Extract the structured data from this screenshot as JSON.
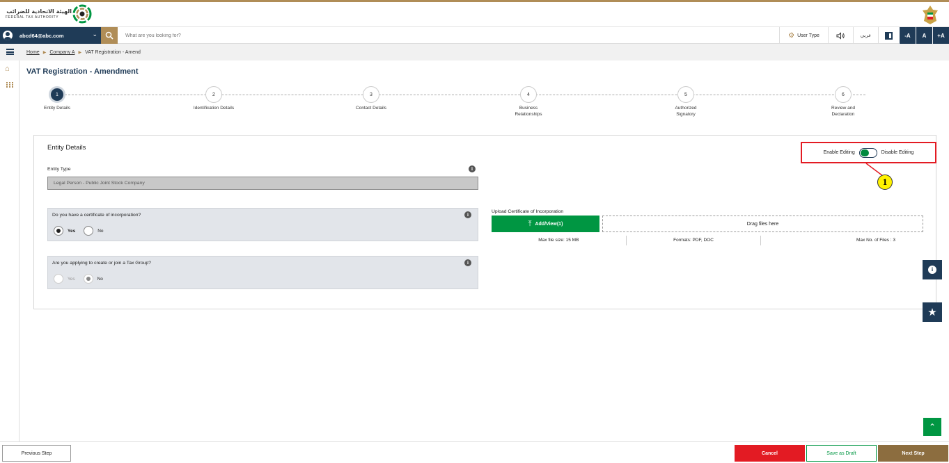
{
  "header": {
    "logo_arabic": "الهيئة الاتحادية للضرائب",
    "logo_english": "FEDERAL TAX AUTHORITY"
  },
  "toolbar": {
    "user_email": "abcd64@abc.com",
    "search_placeholder": "What are you looking for?",
    "user_type_label": "User Type",
    "language_label": "عربي",
    "font_decrease": "-A",
    "font_normal": "A",
    "font_increase": "+A"
  },
  "breadcrumb": {
    "items": [
      "Home",
      "Company A",
      "VAT Registration - Amend"
    ]
  },
  "page": {
    "title": "VAT Registration - Amendment"
  },
  "stepper": {
    "active_index": 0,
    "steps": [
      {
        "number": "1",
        "label": "Entity Details"
      },
      {
        "number": "2",
        "label": "Identification Details"
      },
      {
        "number": "3",
        "label": "Contact Details"
      },
      {
        "number": "4",
        "label": "Business\nRelationships"
      },
      {
        "number": "5",
        "label": "Authorized\nSignatory"
      },
      {
        "number": "6",
        "label": "Review and\nDeclaration"
      }
    ]
  },
  "entity_details": {
    "section_title": "Entity Details",
    "enable_editing_label": "Enable Editing",
    "disable_editing_label": "Disable Editing",
    "editing_enabled": true,
    "callout_number": "1",
    "entity_type_label": "Entity Type",
    "entity_type_value": "Legal Person - Public Joint Stock Company",
    "certificate_question": "Do you have a certificate of incorporation?",
    "certificate_options": [
      "Yes",
      "No"
    ],
    "certificate_selected": "Yes",
    "tax_group_question": "Are you applying to create or join a Tax Group?",
    "tax_group_options": [
      "Yes",
      "No"
    ],
    "tax_group_selected": "No",
    "upload_label": "Upload Certificate of Incorporation",
    "upload_button": "Add/View(1)",
    "drop_zone_text": "Drag files here",
    "max_file_size": "Max file size: 15 MB",
    "formats": "Formats: PDF, DOC",
    "max_files": "Max No. of Files : 3"
  },
  "footer": {
    "previous_label": "Previous Step",
    "cancel_label": "Cancel",
    "draft_label": "Save as Draft",
    "next_label": "Next Step"
  },
  "colors": {
    "primary_navy": "#1f3b57",
    "accent_gold": "#b08d57",
    "success_green": "#009642",
    "danger_red": "#e31b23",
    "callout_yellow": "#fff200"
  },
  "icons": [
    "search-icon",
    "user-avatar-icon",
    "gear-icon",
    "speaker-icon",
    "contrast-icon",
    "menu-icon",
    "home-icon",
    "grid-icon",
    "info-icon",
    "upload-icon",
    "star-icon",
    "chevron-up-icon"
  ]
}
